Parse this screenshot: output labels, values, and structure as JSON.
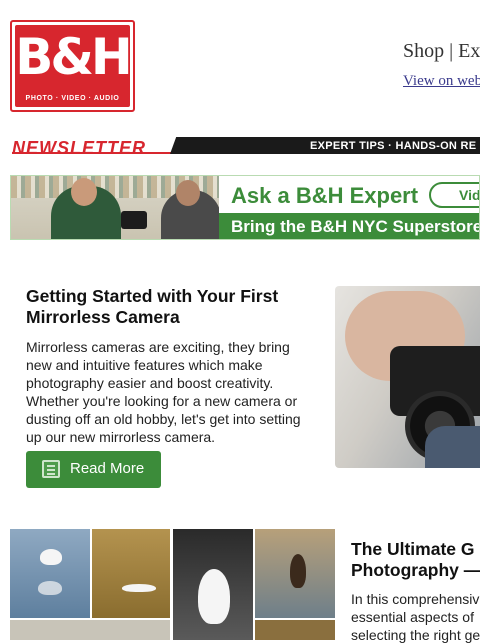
{
  "logo": {
    "mark": "B&H",
    "tagline": "PHOTO · VIDEO · AUDIO"
  },
  "header": {
    "links": [
      {
        "label": "Shop"
      },
      {
        "label": "Ex"
      }
    ],
    "separator": "|",
    "view_web": "View on web"
  },
  "newsletter": {
    "title": "NEWSLETTER",
    "tagline": "EXPERT TIPS · HANDS-ON RE"
  },
  "expert_banner": {
    "title": "Ask a B&H Expert",
    "pill": "Video",
    "strip": "Bring the B&H NYC Superstore Ri"
  },
  "article1": {
    "title": "Getting Started with Your First Mirrorless Camera",
    "body": "Mirrorless cameras are exciting, they bring new and intuitive features which make photography easier and boost creativity. Whether you're looking for a new camera or dusting off an old hobby, let's get into setting up our new mirrorless camera.",
    "button_label": "Read More",
    "button_icon": "article-icon"
  },
  "article2": {
    "title_line1": "The Ultimate G",
    "title_line2": "Photography —",
    "body_line1": "In this comprehensiv",
    "body_line2": "essential aspects of",
    "body_line3": "selecting the right ge"
  },
  "colors": {
    "brand_red": "#d7262e",
    "green": "#3c8c3a"
  }
}
